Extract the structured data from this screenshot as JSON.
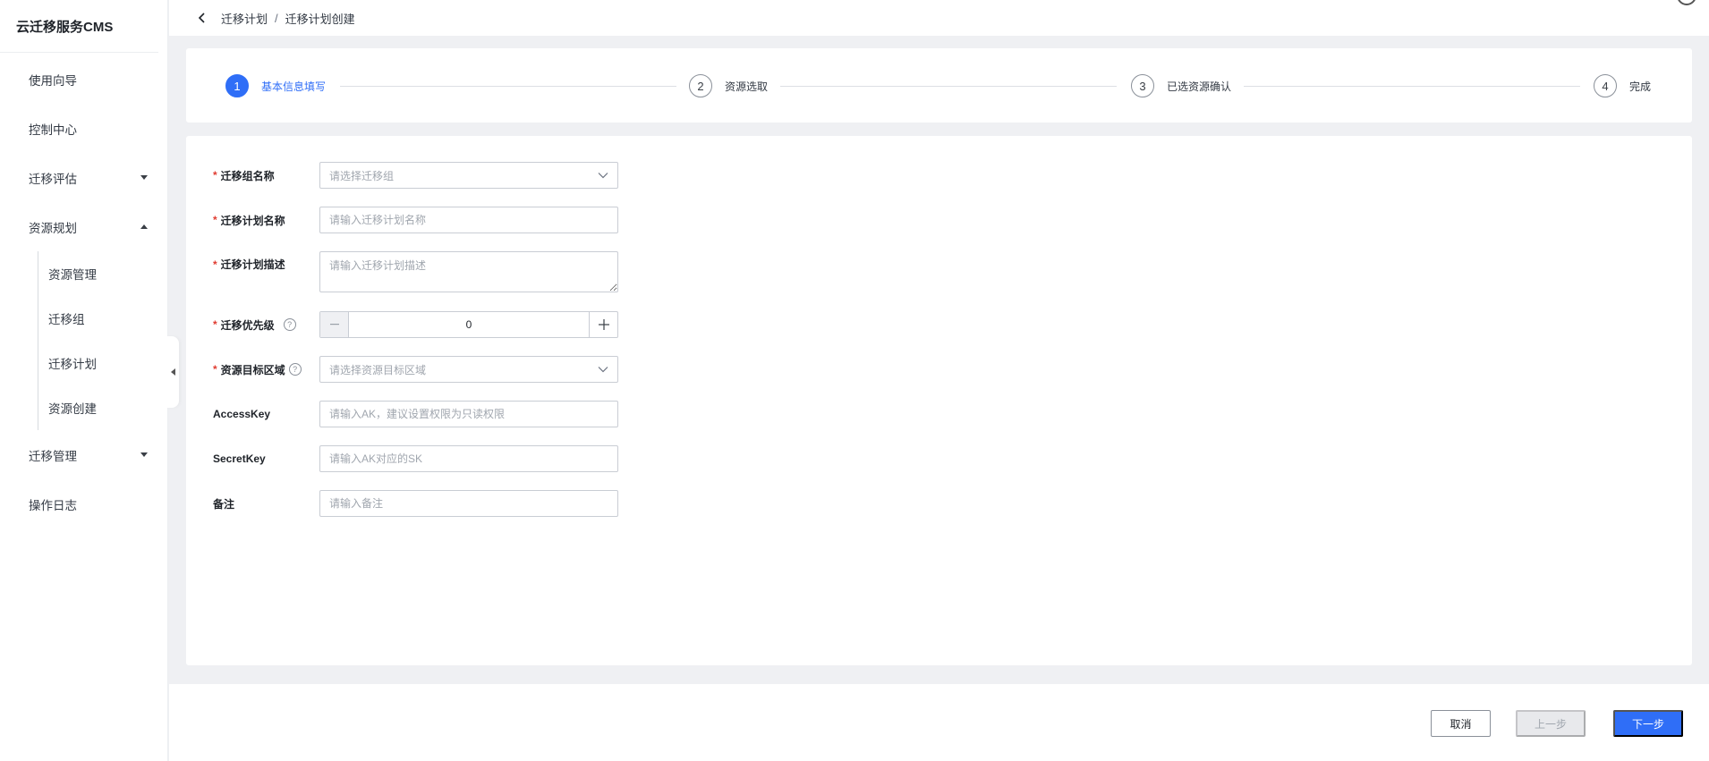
{
  "app": {
    "title": "云迁移服务CMS"
  },
  "sidebar": {
    "items": [
      {
        "label": "使用向导"
      },
      {
        "label": "控制中心"
      },
      {
        "label": "迁移评估"
      },
      {
        "label": "资源规划"
      },
      {
        "label": "迁移管理"
      },
      {
        "label": "操作日志"
      }
    ],
    "sub_items": [
      {
        "label": "资源管理"
      },
      {
        "label": "迁移组"
      },
      {
        "label": "迁移计划"
      },
      {
        "label": "资源创建"
      }
    ]
  },
  "breadcrumb": {
    "parent": "迁移计划",
    "separator": "/",
    "current": "迁移计划创建"
  },
  "steps": [
    {
      "num": "1",
      "label": "基本信息填写"
    },
    {
      "num": "2",
      "label": "资源选取"
    },
    {
      "num": "3",
      "label": "已选资源确认"
    },
    {
      "num": "4",
      "label": "完成"
    }
  ],
  "form": {
    "group_name": {
      "label": "迁移组名称",
      "placeholder": "请选择迁移组"
    },
    "plan_name": {
      "label": "迁移计划名称",
      "placeholder": "请输入迁移计划名称"
    },
    "plan_desc": {
      "label": "迁移计划描述",
      "placeholder": "请输入迁移计划描述"
    },
    "priority": {
      "label": "迁移优先级",
      "value": "0"
    },
    "region": {
      "label": "资源目标区域",
      "placeholder": "请选择资源目标区域"
    },
    "access_key": {
      "label": "AccessKey",
      "placeholder": "请输入AK，建议设置权限为只读权限"
    },
    "secret_key": {
      "label": "SecretKey",
      "placeholder": "请输入AK对应的SK"
    },
    "remark": {
      "label": "备注",
      "placeholder": "请输入备注"
    }
  },
  "footer": {
    "cancel": "取消",
    "prev": "上一步",
    "next": "下一步"
  },
  "colors": {
    "accent": "#2f6ef7",
    "required": "#e03c31"
  }
}
